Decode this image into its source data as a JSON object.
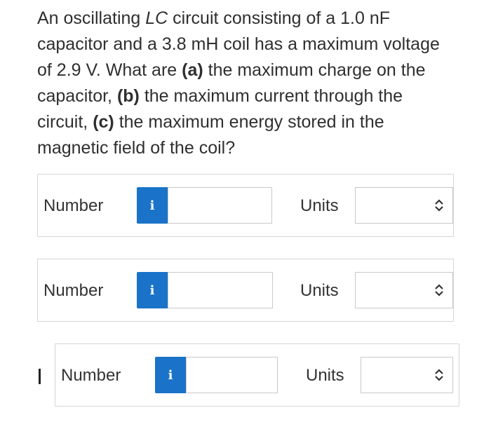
{
  "question": {
    "line1_pre": "An oscillating ",
    "line1_lc": "LC",
    "line1_post": " circuit consisting of a 1.0 nF",
    "line2": "capacitor and a 3.8 mH coil has a maximum voltage",
    "line3_pre": "of 2.9 V. What are ",
    "a_label": "(a)",
    "line3_post": " the maximum charge on the",
    "line4_pre": "capacitor, ",
    "b_label": "(b)",
    "line4_post": " the maximum current through the",
    "line5_pre": "circuit, ",
    "c_label": "(c)",
    "line5_post": " the maximum energy stored in the",
    "line6": "magnetic field of the coil?"
  },
  "answers": [
    {
      "number_label": "Number",
      "info_icon": "i",
      "units_label": "Units",
      "number_value": "",
      "units_value": ""
    },
    {
      "number_label": "Number",
      "info_icon": "i",
      "units_label": "Units",
      "number_value": "",
      "units_value": ""
    },
    {
      "number_label": "Number",
      "info_icon": "i",
      "units_label": "Units",
      "number_value": "",
      "units_value": ""
    }
  ],
  "colors": {
    "info_button": "#1a73c8",
    "border": "#d6d6d6"
  }
}
